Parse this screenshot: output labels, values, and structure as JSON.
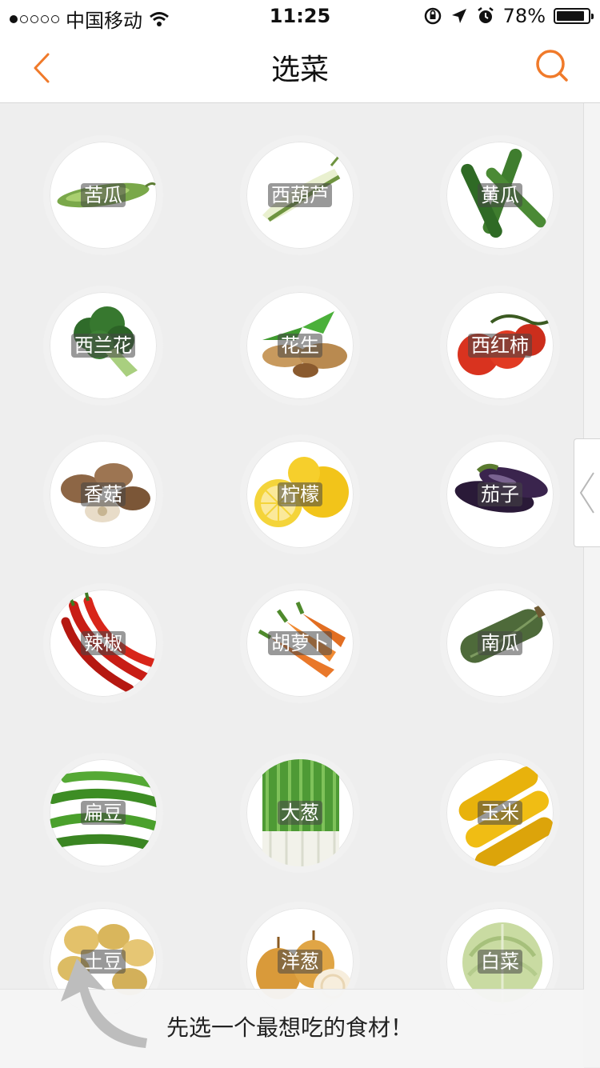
{
  "status": {
    "carrier": "中国移动",
    "time": "11:25",
    "battery": "78%",
    "battery_level": 0.78,
    "signal_bars": 1
  },
  "nav": {
    "title": "选菜",
    "back_icon": "chevron-left-icon",
    "search_icon": "search-icon",
    "accent_color": "#f07a2a"
  },
  "grid": {
    "items": [
      {
        "label": "苦瓜",
        "icon": "bitter-melon"
      },
      {
        "label": "西葫芦",
        "icon": "zucchini"
      },
      {
        "label": "黄瓜",
        "icon": "cucumber"
      },
      {
        "label": "西兰花",
        "icon": "broccoli"
      },
      {
        "label": "花生",
        "icon": "peanut"
      },
      {
        "label": "西红柿",
        "icon": "tomato"
      },
      {
        "label": "香菇",
        "icon": "mushroom"
      },
      {
        "label": "柠檬",
        "icon": "lemon"
      },
      {
        "label": "茄子",
        "icon": "eggplant"
      },
      {
        "label": "辣椒",
        "icon": "chili"
      },
      {
        "label": "胡萝卜",
        "icon": "carrot"
      },
      {
        "label": "南瓜",
        "icon": "squash"
      },
      {
        "label": "扁豆",
        "icon": "green-bean"
      },
      {
        "label": "大葱",
        "icon": "scallion"
      },
      {
        "label": "玉米",
        "icon": "corn"
      },
      {
        "label": "土豆",
        "icon": "potato"
      },
      {
        "label": "洋葱",
        "icon": "onion"
      },
      {
        "label": "白菜",
        "icon": "cabbage"
      }
    ]
  },
  "tip": {
    "text": "先选一个最想吃的食材！",
    "icon": "curved-arrow-icon"
  }
}
